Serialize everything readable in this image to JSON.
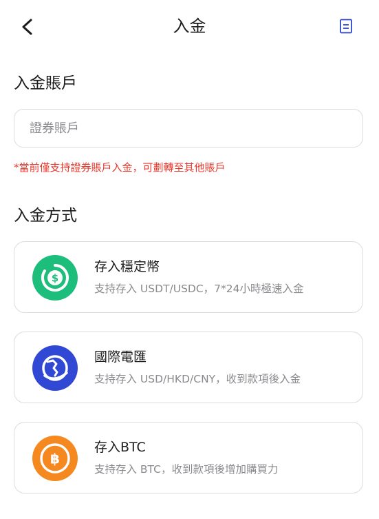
{
  "header": {
    "title": "入金",
    "back_icon": "chevron-left-icon",
    "doc_icon": "document-icon"
  },
  "account_section": {
    "label": "入金賬戶",
    "input": {
      "value": "",
      "placeholder": "證券賬戶"
    },
    "notice": "*當前僅支持證券賬戶入金，可劃轉至其他賬戶"
  },
  "method_section": {
    "label": "入金方式",
    "methods": [
      {
        "title": "存入穩定幣",
        "desc": "支持存入 USDT/USDC，7*24小時極速入金",
        "icon": "stablecoin-dollar-icon",
        "color": "#1dbe7b"
      },
      {
        "title": "國際電匯",
        "desc": "支持存入 USD/HKD/CNY，收到款項後入金",
        "icon": "globe-transfer-icon",
        "color": "#3048d4"
      },
      {
        "title": "存入BTC",
        "desc": "支持存入 BTC，收到款項後增加購買力",
        "icon": "bitcoin-icon",
        "color": "#f5881f"
      }
    ]
  },
  "colors": {
    "accent": "#2f45c8",
    "notice": "#e8382c"
  }
}
